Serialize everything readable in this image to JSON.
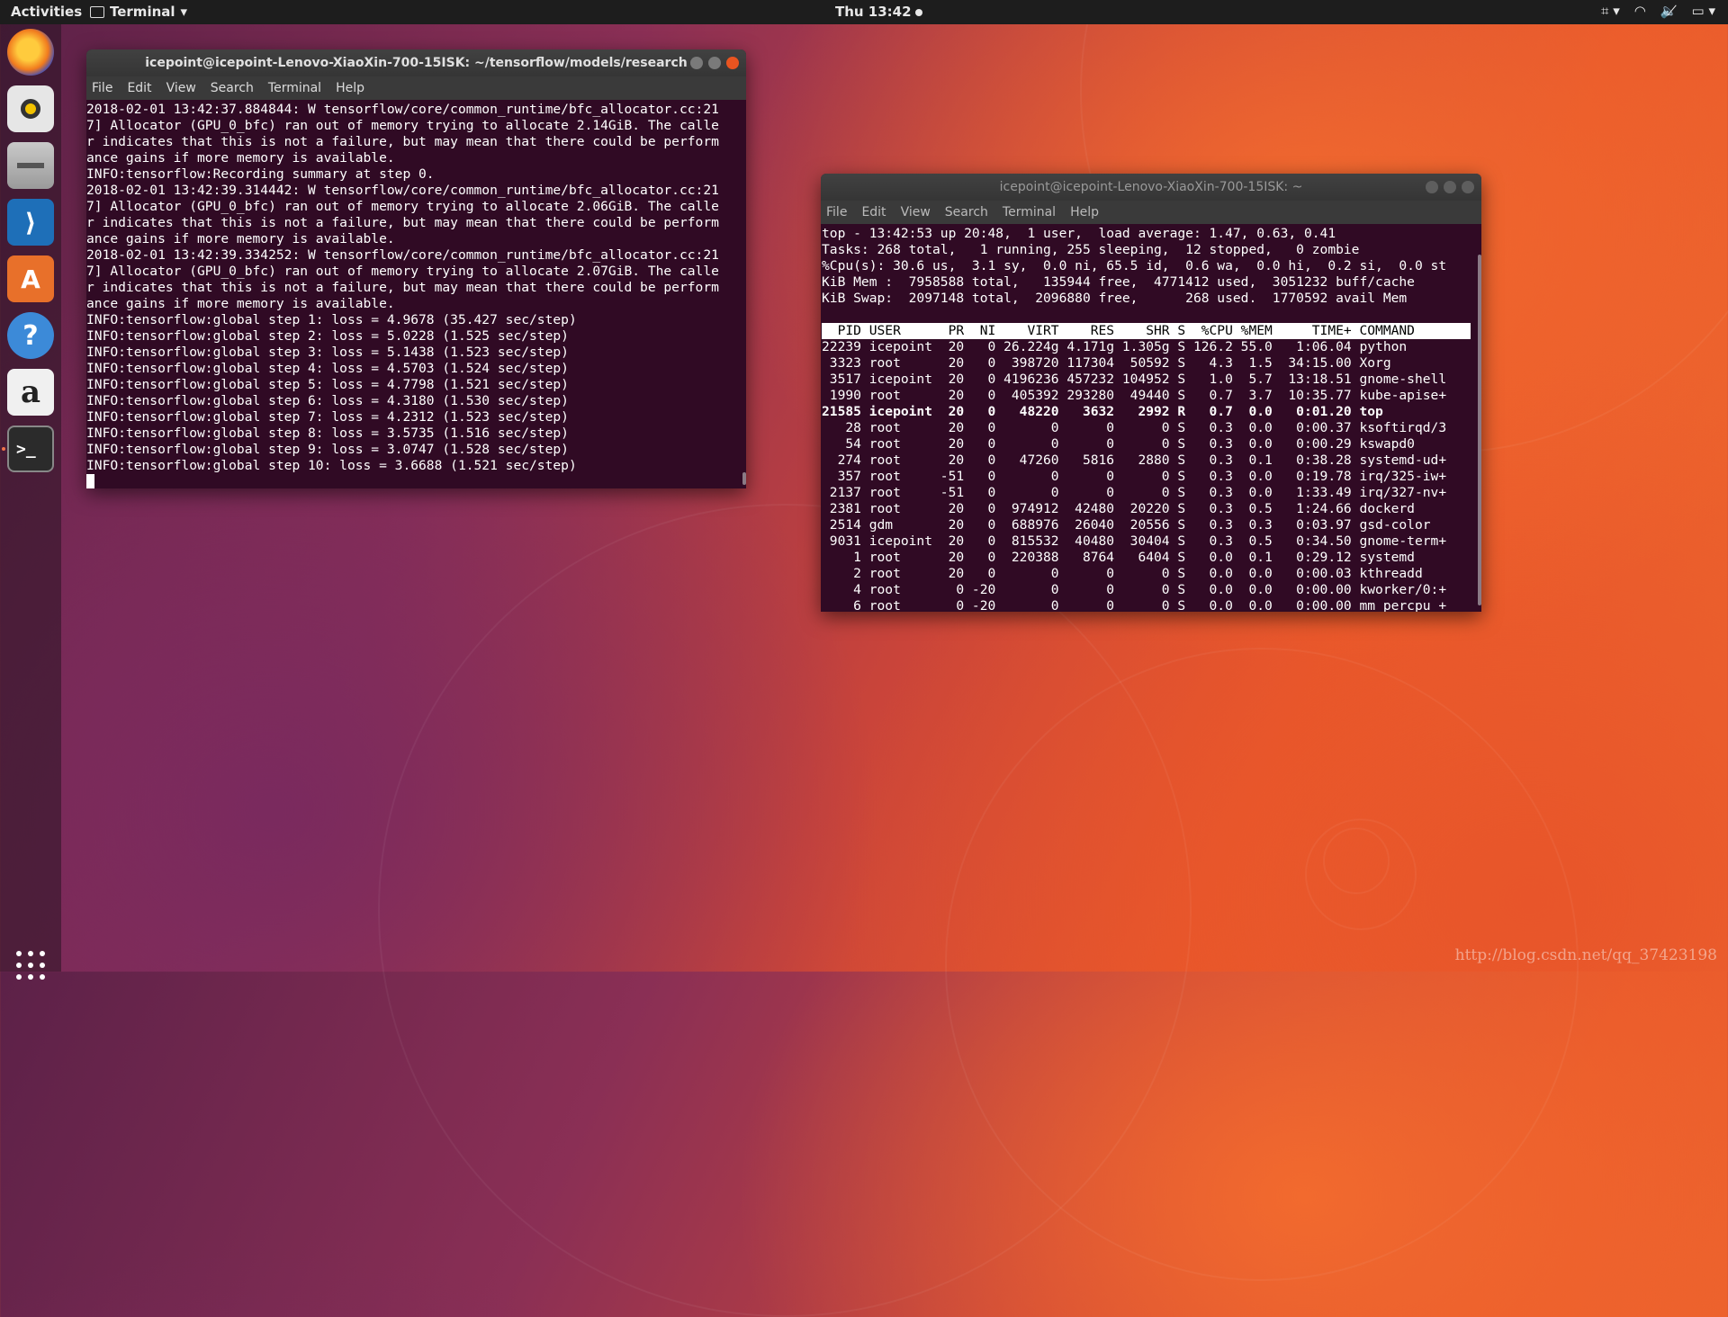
{
  "topbar": {
    "activities": "Activities",
    "app_name": "Terminal",
    "clock": "Thu 13:42",
    "tray": [
      "⌗ ▾",
      "◠",
      "🔈̸",
      "▭ ▾"
    ]
  },
  "dock": {
    "items": [
      "firefox-icon",
      "rhythmbox-icon",
      "files-icon",
      "vscode-icon",
      "software-center-icon",
      "help-icon",
      "amazon-icon",
      "terminal-icon"
    ]
  },
  "window_left": {
    "title": "icepoint@icepoint-Lenovo-XiaoXin-700-15ISK: ~/tensorflow/models/research",
    "menu": [
      "File",
      "Edit",
      "View",
      "Search",
      "Terminal",
      "Help"
    ],
    "lines": [
      "2018-02-01 13:42:37.884844: W tensorflow/core/common_runtime/bfc_allocator.cc:21",
      "7] Allocator (GPU_0_bfc) ran out of memory trying to allocate 2.14GiB. The calle",
      "r indicates that this is not a failure, but may mean that there could be perform",
      "ance gains if more memory is available.",
      "INFO:tensorflow:Recording summary at step 0.",
      "2018-02-01 13:42:39.314442: W tensorflow/core/common_runtime/bfc_allocator.cc:21",
      "7] Allocator (GPU_0_bfc) ran out of memory trying to allocate 2.06GiB. The calle",
      "r indicates that this is not a failure, but may mean that there could be perform",
      "ance gains if more memory is available.",
      "2018-02-01 13:42:39.334252: W tensorflow/core/common_runtime/bfc_allocator.cc:21",
      "7] Allocator (GPU_0_bfc) ran out of memory trying to allocate 2.07GiB. The calle",
      "r indicates that this is not a failure, but may mean that there could be perform",
      "ance gains if more memory is available.",
      "INFO:tensorflow:global step 1: loss = 4.9678 (35.427 sec/step)",
      "INFO:tensorflow:global step 2: loss = 5.0228 (1.525 sec/step)",
      "INFO:tensorflow:global step 3: loss = 5.1438 (1.523 sec/step)",
      "INFO:tensorflow:global step 4: loss = 4.5703 (1.524 sec/step)",
      "INFO:tensorflow:global step 5: loss = 4.7798 (1.521 sec/step)",
      "INFO:tensorflow:global step 6: loss = 4.3180 (1.530 sec/step)",
      "INFO:tensorflow:global step 7: loss = 4.2312 (1.523 sec/step)",
      "INFO:tensorflow:global step 8: loss = 3.5735 (1.516 sec/step)",
      "INFO:tensorflow:global step 9: loss = 3.0747 (1.528 sec/step)",
      "INFO:tensorflow:global step 10: loss = 3.6688 (1.521 sec/step)"
    ]
  },
  "window_right": {
    "title": "icepoint@icepoint-Lenovo-XiaoXin-700-15ISK: ~",
    "menu": [
      "File",
      "Edit",
      "View",
      "Search",
      "Terminal",
      "Help"
    ],
    "summary": [
      "top - 13:42:53 up 20:48,  1 user,  load average: 1.47, 0.63, 0.41",
      "Tasks: 268 total,   1 running, 255 sleeping,  12 stopped,   0 zombie",
      "%Cpu(s): 30.6 us,  3.1 sy,  0.0 ni, 65.5 id,  0.6 wa,  0.0 hi,  0.2 si,  0.0 st",
      "KiB Mem :  7958588 total,   135944 free,  4771412 used,  3051232 buff/cache",
      "KiB Swap:  2097148 total,  2096880 free,      268 used.  1770592 avail Mem",
      ""
    ],
    "header": "  PID USER      PR  NI    VIRT    RES    SHR S  %CPU %MEM     TIME+ COMMAND      ",
    "processes": [
      {
        "text": "22239 icepoint  20   0 26.224g 4.171g 1.305g S 126.2 55.0   1:06.04 python",
        "bold": false
      },
      {
        "text": " 3323 root      20   0  398720 117304  50592 S   4.3  1.5  34:15.00 Xorg",
        "bold": false
      },
      {
        "text": " 3517 icepoint  20   0 4196236 457232 104952 S   1.0  5.7  13:18.51 gnome-shell",
        "bold": false
      },
      {
        "text": " 1990 root      20   0  405392 293280  49440 S   0.7  3.7  10:35.77 kube-apise+",
        "bold": false
      },
      {
        "text": "21585 icepoint  20   0   48220   3632   2992 R   0.7  0.0   0:01.20 top",
        "bold": true
      },
      {
        "text": "   28 root      20   0       0      0      0 S   0.3  0.0   0:00.37 ksoftirqd/3",
        "bold": false
      },
      {
        "text": "   54 root      20   0       0      0      0 S   0.3  0.0   0:00.29 kswapd0",
        "bold": false
      },
      {
        "text": "  274 root      20   0   47260   5816   2880 S   0.3  0.1   0:38.28 systemd-ud+",
        "bold": false
      },
      {
        "text": "  357 root     -51   0       0      0      0 S   0.3  0.0   0:19.78 irq/325-iw+",
        "bold": false
      },
      {
        "text": " 2137 root     -51   0       0      0      0 S   0.3  0.0   1:33.49 irq/327-nv+",
        "bold": false
      },
      {
        "text": " 2381 root      20   0  974912  42480  20220 S   0.3  0.5   1:24.66 dockerd",
        "bold": false
      },
      {
        "text": " 2514 gdm       20   0  688976  26040  20556 S   0.3  0.3   0:03.97 gsd-color",
        "bold": false
      },
      {
        "text": " 9031 icepoint  20   0  815532  40480  30404 S   0.3  0.5   0:34.50 gnome-term+",
        "bold": false
      },
      {
        "text": "    1 root      20   0  220388   8764   6404 S   0.0  0.1   0:29.12 systemd",
        "bold": false
      },
      {
        "text": "    2 root      20   0       0      0      0 S   0.0  0.0   0:00.03 kthreadd",
        "bold": false
      },
      {
        "text": "    4 root       0 -20       0      0      0 S   0.0  0.0   0:00.00 kworker/0:+",
        "bold": false
      },
      {
        "text": "    6 root       0 -20       0      0      0 S   0.0  0.0   0:00.00 mm_percpu_+",
        "bold": false
      }
    ]
  },
  "watermark": "http://blog.csdn.net/qq_37423198"
}
